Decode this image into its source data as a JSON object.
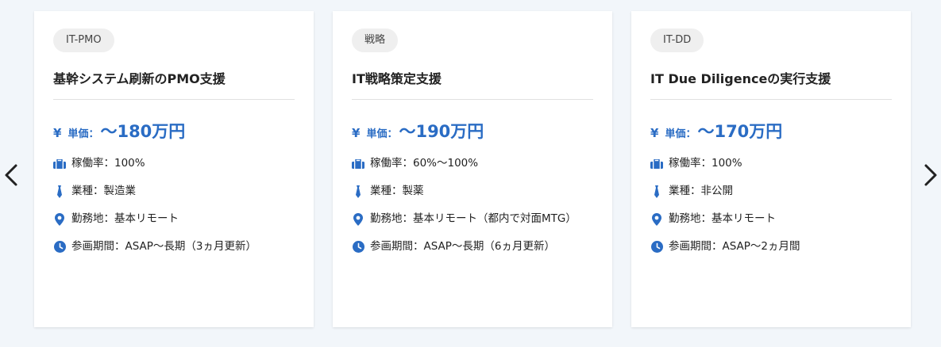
{
  "nav": {
    "prev_icon": "chevron-left-icon",
    "next_icon": "chevron-right-icon"
  },
  "colors": {
    "accent": "#2a6cc4",
    "background": "#f2f6fa"
  },
  "cards": [
    {
      "tag": "IT-PMO",
      "title": "基幹システム刷新のPMO支援",
      "price_yen": "¥",
      "price_label": "単価：",
      "price_value": "〜180万円",
      "rate": "稼働率：100%",
      "industry": "業種：製造業",
      "location": "勤務地：基本リモート",
      "period": "参画期間：ASAP〜長期（3ヵ月更新）"
    },
    {
      "tag": "戦略",
      "title": "IT戦略策定支援",
      "price_yen": "¥",
      "price_label": "単価：",
      "price_value": "〜190万円",
      "rate": "稼働率：60%〜100%",
      "industry": "業種：製薬",
      "location": "勤務地：基本リモート（都内で対面MTG）",
      "period": "参画期間：ASAP〜長期（6ヵ月更新）"
    },
    {
      "tag": "IT-DD",
      "title": "IT Due Diligenceの実行支援",
      "price_yen": "¥",
      "price_label": "単価：",
      "price_value": "〜170万円",
      "rate": "稼働率：100%",
      "industry": "業種：非公開",
      "location": "勤務地：基本リモート",
      "period": "参画期間：ASAP〜2ヵ月間"
    }
  ]
}
